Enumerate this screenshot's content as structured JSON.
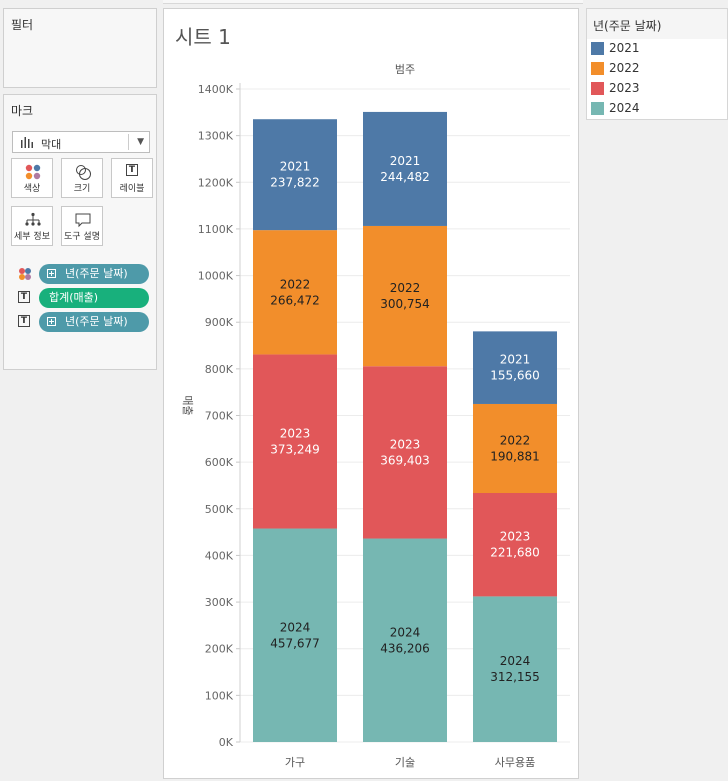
{
  "filters": {
    "title": "필터"
  },
  "marks": {
    "title": "마크",
    "mark_type": "막대",
    "buttons": [
      {
        "label": "색상",
        "icon": "color-icon"
      },
      {
        "label": "크기",
        "icon": "size-icon"
      },
      {
        "label": "레이블",
        "icon": "label-icon"
      },
      {
        "label": "세부 정보",
        "icon": "detail-icon"
      },
      {
        "label": "도구 설명",
        "icon": "tooltip-icon"
      }
    ],
    "pills": [
      {
        "type_icon": "color-dots-icon",
        "text": "년(주문 날짜)",
        "color": "#4e9aa9"
      },
      {
        "type_icon": "text-icon",
        "text": "합계(매출)",
        "color": "#18b07c"
      },
      {
        "type_icon": "text-icon",
        "text": "년(주문 날짜)",
        "color": "#4e9aa9"
      }
    ]
  },
  "sheet": {
    "title": "시트 1"
  },
  "legend": {
    "title": "년(주문 날짜)",
    "items": [
      {
        "label": "2021",
        "color": "#4e79a7"
      },
      {
        "label": "2022",
        "color": "#f28e2b"
      },
      {
        "label": "2023",
        "color": "#e15759"
      },
      {
        "label": "2024",
        "color": "#76b7b2"
      }
    ]
  },
  "chart_data": {
    "type": "bar",
    "stacked": true,
    "column_header": "범주",
    "ylabel": "매출",
    "ylim": [
      0,
      1400000
    ],
    "y_ticks": [
      0,
      100000,
      200000,
      300000,
      400000,
      500000,
      600000,
      700000,
      800000,
      900000,
      1000000,
      1100000,
      1200000,
      1300000,
      1400000
    ],
    "y_tick_labels": [
      "0K",
      "100K",
      "200K",
      "300K",
      "400K",
      "500K",
      "600K",
      "700K",
      "800K",
      "900K",
      "1000K",
      "1100K",
      "1200K",
      "1300K",
      "1400K"
    ],
    "categories": [
      "가구",
      "기술",
      "사무용품"
    ],
    "series": [
      {
        "name": "2024",
        "color": "#76b7b2",
        "label_color": "#222222",
        "values": [
          457677,
          436206,
          312155
        ],
        "value_labels": [
          "457,677",
          "436,206",
          "312,155"
        ]
      },
      {
        "name": "2023",
        "color": "#e15759",
        "label_color": "#ffffff",
        "values": [
          373249,
          369403,
          221680
        ],
        "value_labels": [
          "373,249",
          "369,403",
          "221,680"
        ]
      },
      {
        "name": "2022",
        "color": "#f28e2b",
        "label_color": "#222222",
        "values": [
          266472,
          300754,
          190881
        ],
        "value_labels": [
          "266,472",
          "300,754",
          "190,881"
        ]
      },
      {
        "name": "2021",
        "color": "#4e79a7",
        "label_color": "#ffffff",
        "values": [
          237822,
          244482,
          155660
        ],
        "value_labels": [
          "237,822",
          "244,482",
          "155,660"
        ]
      }
    ],
    "grid": true,
    "legend_position": "right"
  }
}
